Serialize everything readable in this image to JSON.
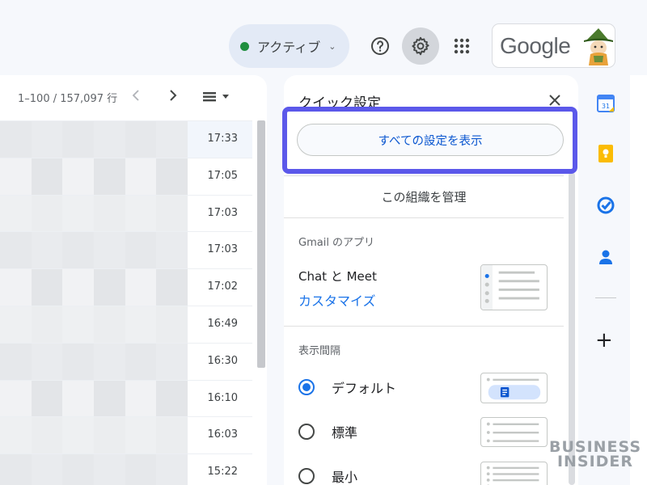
{
  "topbar": {
    "status_label": "アクティブ",
    "status_color": "#1e8e3e",
    "help_icon": "help-circle-icon",
    "settings_icon": "gear-icon",
    "apps_icon": "apps-grid-icon",
    "account_logo": "Google"
  },
  "mail_list": {
    "page_count": "1–100 / 157,097 行",
    "rows": [
      {
        "time": "17:33"
      },
      {
        "time": "17:05"
      },
      {
        "time": "17:03"
      },
      {
        "time": "17:03"
      },
      {
        "time": "17:02"
      },
      {
        "time": "16:49"
      },
      {
        "time": "16:30"
      },
      {
        "time": "16:10"
      },
      {
        "time": "16:03"
      },
      {
        "time": "15:22"
      }
    ]
  },
  "quick_settings": {
    "title": "クイック設定",
    "view_all_button": "すべての設定を表示",
    "manage_org": "この組織を管理",
    "apps_section_label": "Gmail のアプリ",
    "apps_title": "Chat と Meet",
    "customize_link": "カスタマイズ",
    "density_section_label": "表示間隔",
    "density_options": [
      {
        "label": "デフォルト",
        "selected": true
      },
      {
        "label": "標準",
        "selected": false
      },
      {
        "label": "最小",
        "selected": false
      }
    ],
    "highlight_color": "#5b58ea"
  },
  "side_rail": {
    "calendar_badge": "31",
    "icons": [
      "calendar-icon",
      "keep-icon",
      "tasks-icon",
      "contacts-icon",
      "add-icon"
    ],
    "add_label": "+"
  },
  "watermark": {
    "line1": "BUSINESS",
    "line2": "INSIDER"
  }
}
